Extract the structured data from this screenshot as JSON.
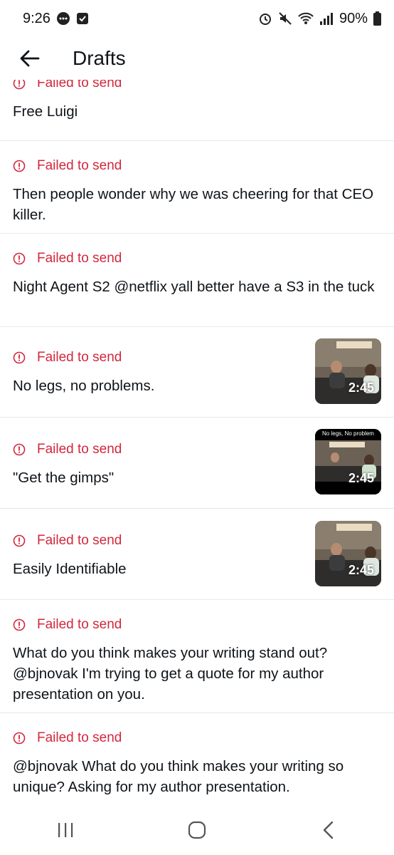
{
  "status_bar": {
    "time": "9:26",
    "battery": "90%"
  },
  "header": {
    "title": "Drafts"
  },
  "drafts": [
    {
      "status": "Failed to send",
      "text": "Free Luigi"
    },
    {
      "status": "Failed to send",
      "text": "Then people wonder why we was cheering for that CEO killer."
    },
    {
      "status": "Failed to send",
      "text": "Night Agent S2 @netflix yall better have a S3 in the tuck"
    },
    {
      "status": "Failed to send",
      "text": "No legs, no problems.",
      "duration": "2:45"
    },
    {
      "status": "Failed to send",
      "text": "\"Get the gimps\"",
      "duration": "2:45",
      "caption": "No legs, No problem"
    },
    {
      "status": "Failed to send",
      "text": "Easily Identifiable",
      "duration": "2:45"
    },
    {
      "status": "Failed to send",
      "text": "What do you think makes your writing stand out? @bjnovak I'm trying to get a quote for my author presentation on you."
    },
    {
      "status": "Failed to send",
      "text": "@bjnovak What do you think makes your writing so unique?  Asking for my author presentation."
    }
  ],
  "icons": {
    "back": "arrow-left-icon",
    "error": "error-circle-icon",
    "nav": [
      "recents-icon",
      "home-icon",
      "back-nav-icon"
    ]
  },
  "colors": {
    "error": "#d1283c",
    "text": "#0f1419",
    "divider": "#e6e8eb"
  }
}
